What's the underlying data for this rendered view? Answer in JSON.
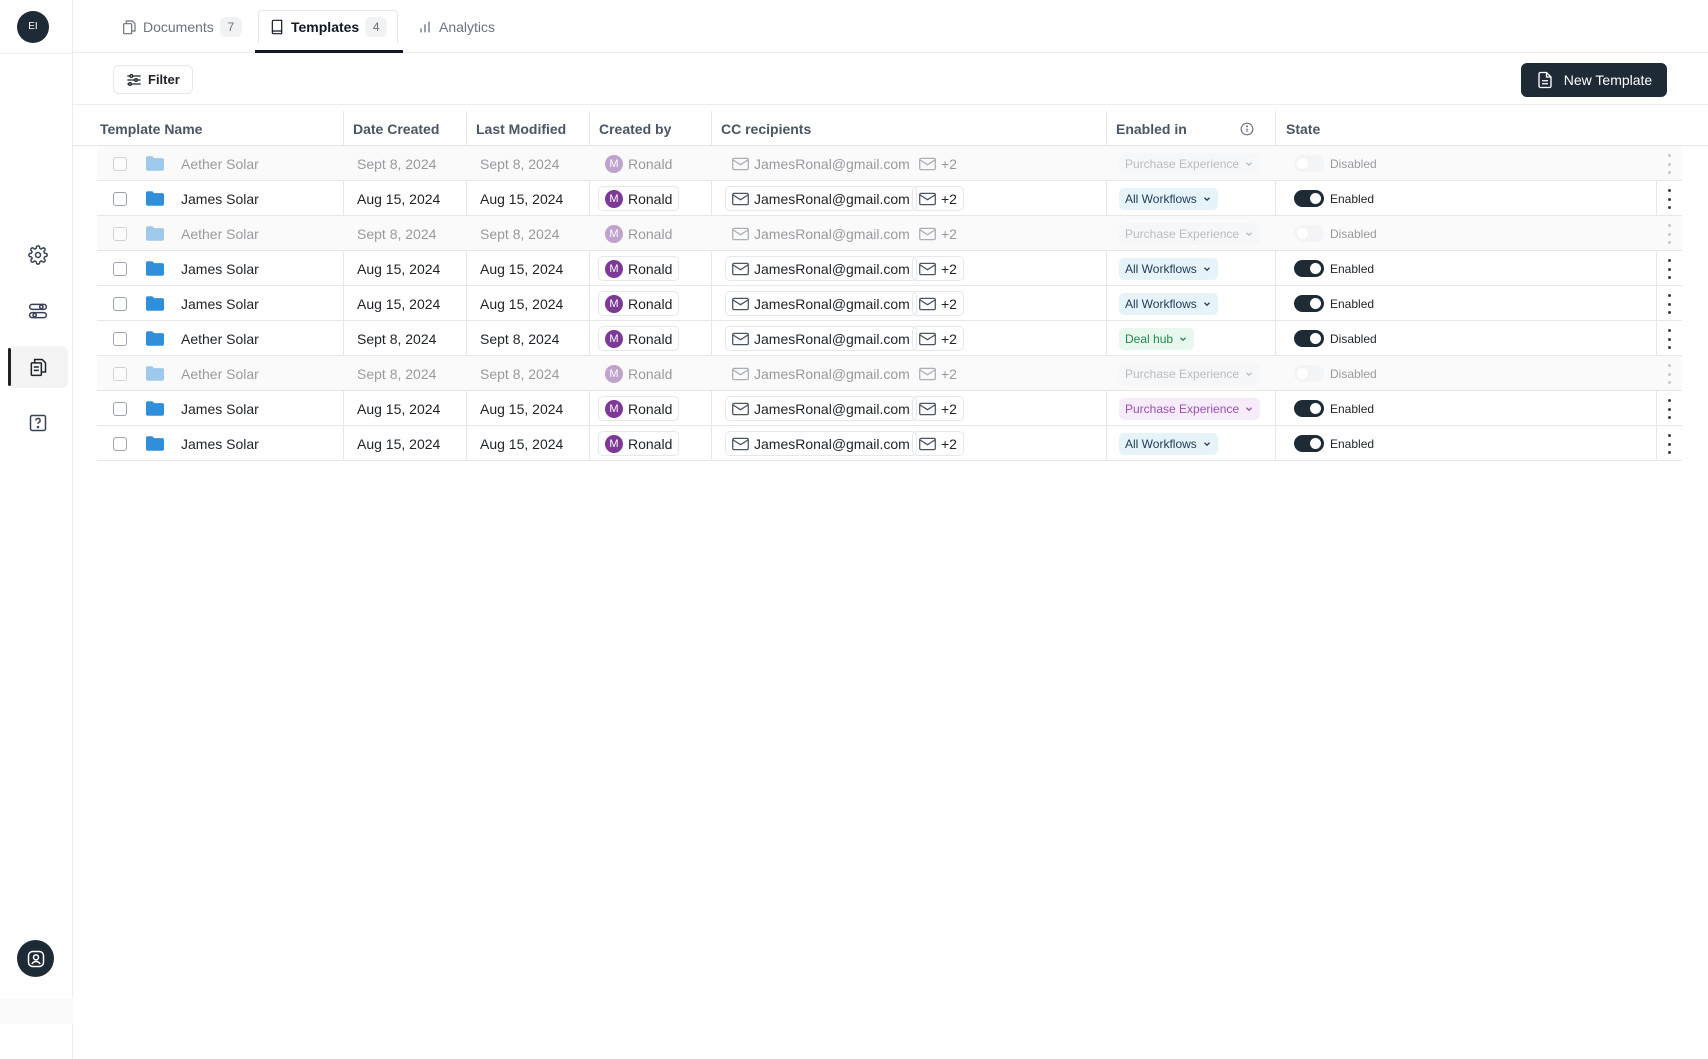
{
  "sidebar": {
    "logo_text": "EI",
    "items": [
      {
        "icon": "gear-icon"
      },
      {
        "icon": "sliders-icon"
      },
      {
        "icon": "documents-icon",
        "active": true
      },
      {
        "icon": "help-icon"
      }
    ],
    "profile_icon": "user-circle-icon"
  },
  "tabs": [
    {
      "label": "Documents",
      "count": "7",
      "icon": "documents-icon"
    },
    {
      "label": "Templates",
      "count": "4",
      "icon": "book-icon",
      "active": true
    },
    {
      "label": "Analytics",
      "count": "",
      "icon": "bar-chart-icon"
    }
  ],
  "toolbar": {
    "filter_label": "Filter",
    "new_template_label": "New Template"
  },
  "table": {
    "headers": {
      "name": "Template Name",
      "date_created": "Date Created",
      "last_modified": "Last Modified",
      "created_by": "Created by",
      "cc": "CC recipients",
      "enabled_in": "Enabled in",
      "state": "State"
    },
    "rows": [
      {
        "name": "Aether Solar",
        "created": "Sept 8, 2024",
        "modified": "Sept 8, 2024",
        "author": "Ronald",
        "author_initial": "M",
        "email": "JamesRonal@gmail.com",
        "extra": "+2",
        "enabled_in": "Purchase Experience",
        "enabled_style": "grey",
        "state": "Disabled",
        "on": false,
        "dim": true
      },
      {
        "name": "James Solar",
        "created": "Aug 15, 2024",
        "modified": "Aug 15, 2024",
        "author": "Ronald",
        "author_initial": "M",
        "email": "JamesRonal@gmail.com",
        "extra": "+2",
        "enabled_in": "All Workflows",
        "enabled_style": "blue",
        "state": "Enabled",
        "on": true,
        "dim": false
      },
      {
        "name": "Aether Solar",
        "created": "Sept 8, 2024",
        "modified": "Sept 8, 2024",
        "author": "Ronald",
        "author_initial": "M",
        "email": "JamesRonal@gmail.com",
        "extra": "+2",
        "enabled_in": "Purchase Experience",
        "enabled_style": "grey",
        "state": "Disabled",
        "on": false,
        "dim": true
      },
      {
        "name": "James Solar",
        "created": "Aug 15, 2024",
        "modified": "Aug 15, 2024",
        "author": "Ronald",
        "author_initial": "M",
        "email": "JamesRonal@gmail.com",
        "extra": "+2",
        "enabled_in": "All Workflows",
        "enabled_style": "blue",
        "state": "Enabled",
        "on": true,
        "dim": false
      },
      {
        "name": "James Solar",
        "created": "Aug 15, 2024",
        "modified": "Aug 15, 2024",
        "author": "Ronald",
        "author_initial": "M",
        "email": "JamesRonal@gmail.com",
        "extra": "+2",
        "enabled_in": "All Workflows",
        "enabled_style": "blue",
        "state": "Enabled",
        "on": true,
        "dim": false
      },
      {
        "name": "Aether Solar",
        "created": "Sept 8, 2024",
        "modified": "Sept 8, 2024",
        "author": "Ronald",
        "author_initial": "M",
        "email": "JamesRonal@gmail.com",
        "extra": "+2",
        "enabled_in": "Deal hub",
        "enabled_style": "green",
        "state": "Disabled",
        "on": true,
        "dim": false
      },
      {
        "name": "Aether Solar",
        "created": "Sept 8, 2024",
        "modified": "Sept 8, 2024",
        "author": "Ronald",
        "author_initial": "M",
        "email": "JamesRonal@gmail.com",
        "extra": "+2",
        "enabled_in": "Purchase Experience",
        "enabled_style": "grey",
        "state": "Disabled",
        "on": false,
        "dim": true
      },
      {
        "name": "James Solar",
        "created": "Aug 15, 2024",
        "modified": "Aug 15, 2024",
        "author": "Ronald",
        "author_initial": "M",
        "email": "JamesRonal@gmail.com",
        "extra": "+2",
        "enabled_in": "Purchase Experience",
        "enabled_style": "purple",
        "state": "Enabled",
        "on": true,
        "dim": false
      },
      {
        "name": "James Solar",
        "created": "Aug 15, 2024",
        "modified": "Aug 15, 2024",
        "author": "Ronald",
        "author_initial": "M",
        "email": "JamesRonal@gmail.com",
        "extra": "+2",
        "enabled_in": "All Workflows",
        "enabled_style": "blue",
        "state": "Enabled",
        "on": true,
        "dim": false
      }
    ]
  },
  "colors": {
    "primary_dark": "#1f2a37",
    "folder_blue": "#2f8fdb",
    "avatar_purple": "#7c3a96"
  }
}
